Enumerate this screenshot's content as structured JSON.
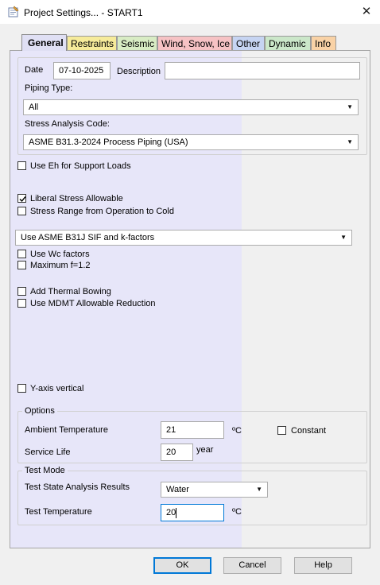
{
  "window": {
    "title": "Project Settings... - START1"
  },
  "tabs": [
    {
      "label": "General",
      "color": "#e0e0f4"
    },
    {
      "label": "Restraints",
      "color": "#f6eb9a"
    },
    {
      "label": "Seismic",
      "color": "#d8ecc4"
    },
    {
      "label": "Wind, Snow, Ice",
      "color": "#f6c2c4"
    },
    {
      "label": "Other",
      "color": "#c6d4f2"
    },
    {
      "label": "Dynamic",
      "color": "#cbe7c9"
    },
    {
      "label": "Info",
      "color": "#f9d2a6"
    }
  ],
  "general": {
    "date_label": "Date",
    "date_value": "07-10-2025",
    "description_label": "Description",
    "description_value": "",
    "piping_type_label": "Piping Type:",
    "piping_type_value": "All",
    "code_label": "Stress Analysis Code:",
    "code_value": "ASME B31.3-2024 Process Piping (USA)",
    "use_eh_label": "Use Eh for Support Loads",
    "use_eh_checked": false,
    "liberal_label": "Liberal Stress Allowable",
    "liberal_checked": true,
    "stress_range_label": "Stress Range from Operation to Cold",
    "stress_range_checked": false,
    "sif_value": "Use ASME B31J SIF and k-factors",
    "use_wc_label": "Use Wc factors",
    "use_wc_checked": false,
    "max_f_label": "Maximum f=1.2",
    "max_f_checked": false,
    "thermal_bowing_label": "Add Thermal Bowing",
    "thermal_bowing_checked": false,
    "mdmt_label": "Use MDMT Allowable Reduction",
    "mdmt_checked": false,
    "y_axis_label": "Y-axis vertical",
    "y_axis_checked": false
  },
  "options": {
    "group_label": "Options",
    "ambient_label": "Ambient Temperature",
    "ambient_value": "21",
    "ambient_unit": "ºC",
    "constant_label": "Constant",
    "constant_checked": false,
    "service_life_label": "Service Life",
    "service_life_value": "20",
    "service_life_unit": "year"
  },
  "test_mode": {
    "group_label": "Test Mode",
    "results_label": "Test State Analysis Results",
    "results_value": "Water",
    "temperature_label": "Test Temperature",
    "temperature_value": "20",
    "temperature_unit": "ºC"
  },
  "buttons": {
    "ok": "OK",
    "cancel": "Cancel",
    "help": "Help"
  }
}
